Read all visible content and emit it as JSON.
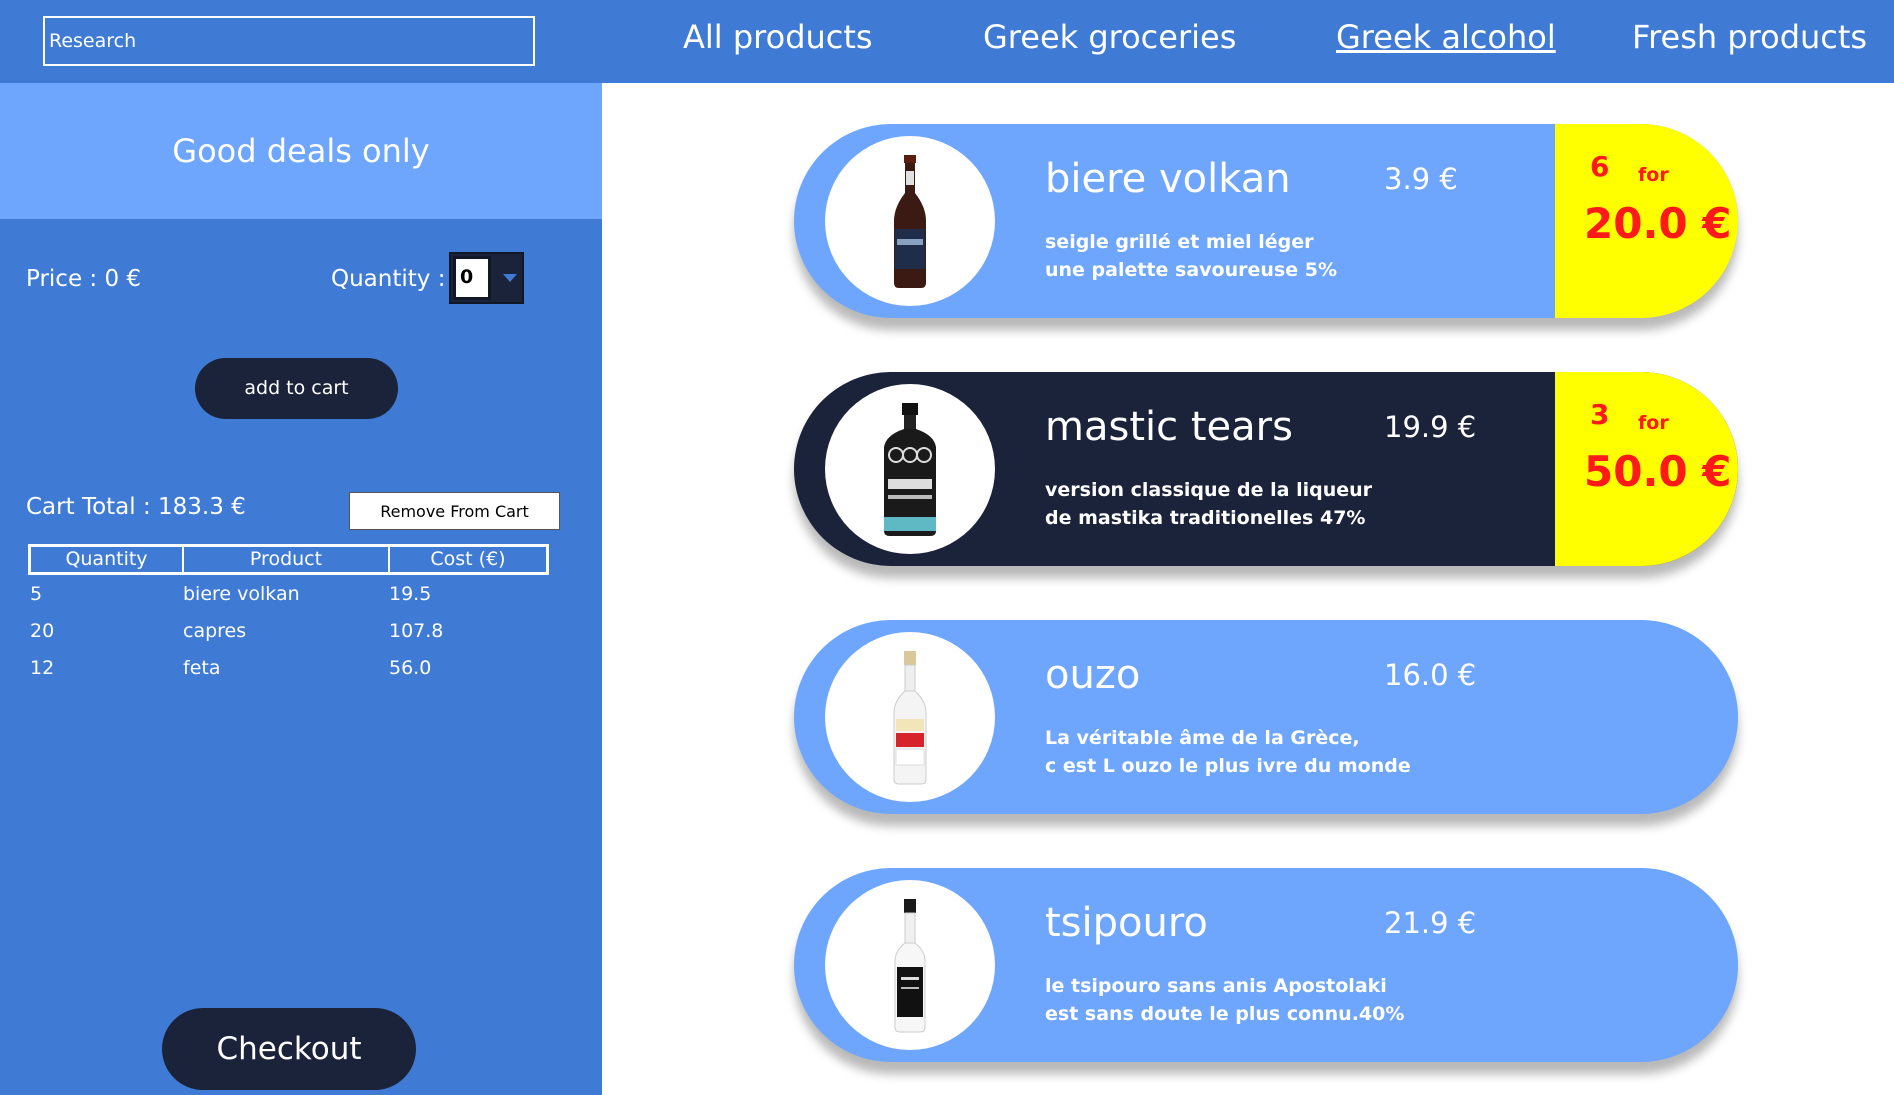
{
  "search": {
    "placeholder": "Research",
    "value": ""
  },
  "nav": {
    "items": [
      {
        "label": "All products"
      },
      {
        "label": "Greek groceries"
      },
      {
        "label": "Greek alcohol",
        "active": true
      },
      {
        "label": "Fresh products"
      }
    ]
  },
  "sidebar": {
    "deals_label": "Good deals only",
    "price_label": "Price : 0 €",
    "quantity_label": "Quantity :",
    "quantity_value": "0",
    "add_label": "add to cart",
    "cart_total_label": "Cart Total : 183.3 €",
    "remove_label": "Remove From Cart",
    "checkout_label": "Checkout"
  },
  "cart": {
    "headers": [
      "Quantity",
      "Product",
      "Cost (€)"
    ],
    "rows": [
      {
        "quantity": "5",
        "product": "biere volkan",
        "cost": "19.5"
      },
      {
        "quantity": "20",
        "product": "capres",
        "cost": "107.8"
      },
      {
        "quantity": "12",
        "product": "feta",
        "cost": "56.0"
      }
    ]
  },
  "products": [
    {
      "name": "biere volkan",
      "price": "3.9 €",
      "desc1": "seigle grillé et miel léger",
      "desc2": "une palette savoureuse 5%",
      "promo_qty": "6",
      "promo_for": "for",
      "promo_price": "20.0 €",
      "theme": "light",
      "icon": "beer-bottle-icon"
    },
    {
      "name": "mastic tears",
      "price": "19.9 €",
      "desc1": "version classique de la liqueur",
      "desc2": "de mastika traditionelles 47%",
      "promo_qty": "3",
      "promo_for": "for",
      "promo_price": "50.0 €",
      "theme": "dark",
      "icon": "liqueur-bottle-icon"
    },
    {
      "name": "ouzo",
      "price": "16.0 €",
      "desc1": "La véritable âme de la Grèce,",
      "desc2": "c est L ouzo le plus ivre du monde",
      "theme": "light",
      "icon": "ouzo-bottle-icon"
    },
    {
      "name": "tsipouro",
      "price": "21.9 €",
      "desc1": "le tsipouro sans anis Apostolaki",
      "desc2": "est sans doute le plus connu.40%",
      "theme": "light",
      "icon": "tsipouro-bottle-icon"
    }
  ],
  "colors": {
    "primary_blue": "#3f7bd4",
    "light_blue": "#6fa6fd",
    "navy": "#1a233a",
    "promo_yellow": "#ffff00",
    "promo_red": "#ff1a1a"
  }
}
